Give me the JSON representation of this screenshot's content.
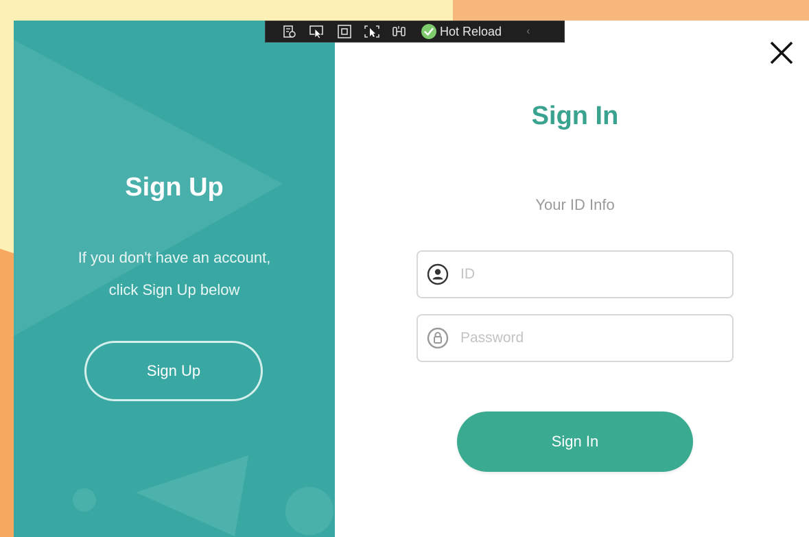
{
  "toolbar": {
    "icons": [
      "live-visual-tree-icon",
      "select-element-icon",
      "display-adorners-icon",
      "track-focus-icon",
      "binding-failures-icon"
    ],
    "hot_reload_label": "Hot Reload",
    "chevron": "‹"
  },
  "left_panel": {
    "title": "Sign Up",
    "description_line1": "If you don't have an account,",
    "description_line2": "click Sign Up below",
    "button_label": "Sign Up"
  },
  "right_panel": {
    "title": "Sign In",
    "subtitle": "Your ID Info",
    "id_field": {
      "placeholder": "ID",
      "value": ""
    },
    "password_field": {
      "placeholder": "Password",
      "value": ""
    },
    "button_label": "Sign In"
  },
  "colors": {
    "teal_panel": "#3aa8a2",
    "teal_accent": "#3aab90",
    "title_teal": "#3aa38f",
    "background_orange": "#f8b77d",
    "background_cream": "#fdf0b4"
  }
}
